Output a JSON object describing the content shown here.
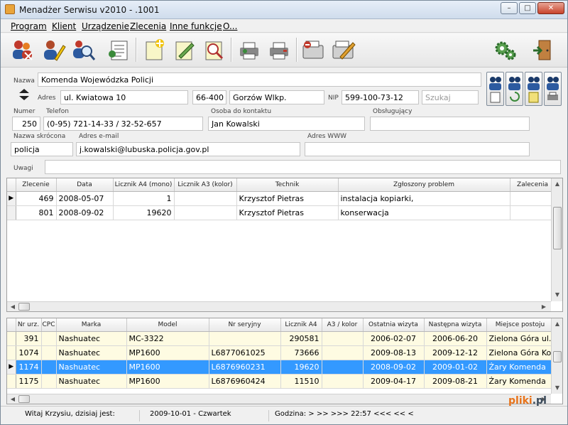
{
  "window": {
    "title": "Menadżer Serwisu v2010 -         .1001",
    "controls": [
      "–",
      "□",
      "✕"
    ]
  },
  "menu": [
    "Program",
    "Klient",
    "Urządzenie",
    "Zlecenia",
    "Inne funkcje",
    "O..."
  ],
  "toolbar_icons": [
    "users-remove-icon",
    "user-edit-icon",
    "users-search-icon",
    "client-list-icon",
    "new-order-icon",
    "edit-order-icon",
    "search-order-icon",
    "printer-icon",
    "print-icon",
    "delete-device-icon",
    "edit-device-icon",
    "settings-icon",
    "exit-icon"
  ],
  "client": {
    "name_label": "Nazwa",
    "name": "Komenda Wojewódzka Policji",
    "address_label": "Adres",
    "street": "ul. Kwiatowa 10",
    "zip": "66-400",
    "city": "Gorzów Wlkp.",
    "nip_label": "NIP",
    "nip": "599-100-73-12",
    "search_placeholder": "Szukaj",
    "number_label": "Numer",
    "number": "250",
    "phone_label": "Telefon",
    "phone": "(0-95) 721-14-33 / 32-52-657",
    "contact_label": "Osoba do kontaktu",
    "contact": "Jan Kowalski",
    "handler_label": "Obsługujący",
    "handler": "",
    "short_name_label": "Nazwa skrócona",
    "short_name": "policja",
    "email_label": "Adres e-mail",
    "email": "j.kowalski@lubuska.policja.gov.pl",
    "www_label": "Adres WWW",
    "www": "",
    "notes_label": "Uwagi",
    "notes": ""
  },
  "orders": {
    "columns": [
      "Zlecenie",
      "Data",
      "Licznik A4 (mono)",
      "Licznik A3 (kolor)",
      "Technik",
      "Zgłoszony problem",
      "Zalecenia"
    ],
    "rows": [
      [
        "469",
        "2008-05-07",
        "1",
        "",
        "Krzysztof Pietras",
        "instalacja kopiarki,",
        ""
      ],
      [
        "801",
        "2008-09-02",
        "19620",
        "",
        "Krzysztof Pietras",
        "konserwacja",
        ""
      ]
    ]
  },
  "devices": {
    "columns": [
      "Nr urz.",
      "CPC",
      "Marka",
      "Model",
      "Nr seryjny",
      "Licznik A4",
      "A3 / kolor",
      "Ostatnia wizyta",
      "Następna wizyta",
      "Miejsce postoju"
    ],
    "rows": [
      [
        "391",
        "",
        "Nashuatec",
        "MC-3322",
        "",
        "290581",
        "",
        "2006-02-07",
        "2006-06-20",
        "Zielona Góra ul."
      ],
      [
        "1074",
        "",
        "Nashuatec",
        "MP1600",
        "L6877061025",
        "73666",
        "",
        "2009-08-13",
        "2009-12-12",
        "Zielona Góra Ko"
      ],
      [
        "1174",
        "",
        "Nashuatec",
        "MP1600",
        "L6876960231",
        "19620",
        "",
        "2008-09-02",
        "2009-01-02",
        "Żary  Komenda"
      ],
      [
        "1175",
        "",
        "Nashuatec",
        "MP1600",
        "L6876960424",
        "11510",
        "",
        "2009-04-17",
        "2009-08-21",
        "Żary  Komenda"
      ]
    ],
    "selected_row": 2
  },
  "status": {
    "greeting": "Witaj Krzysiu, dzisiaj jest:",
    "date": "2009-10-01  -  Czwartek",
    "time_label": "Godzina:  > >> >>>  22:57  <<< << <"
  },
  "watermark": {
    "pre": "",
    "brand": "pliki",
    "suffix": ".pl"
  },
  "colors": {
    "selection": "#3399ff",
    "device_row": "#fefbe2"
  }
}
